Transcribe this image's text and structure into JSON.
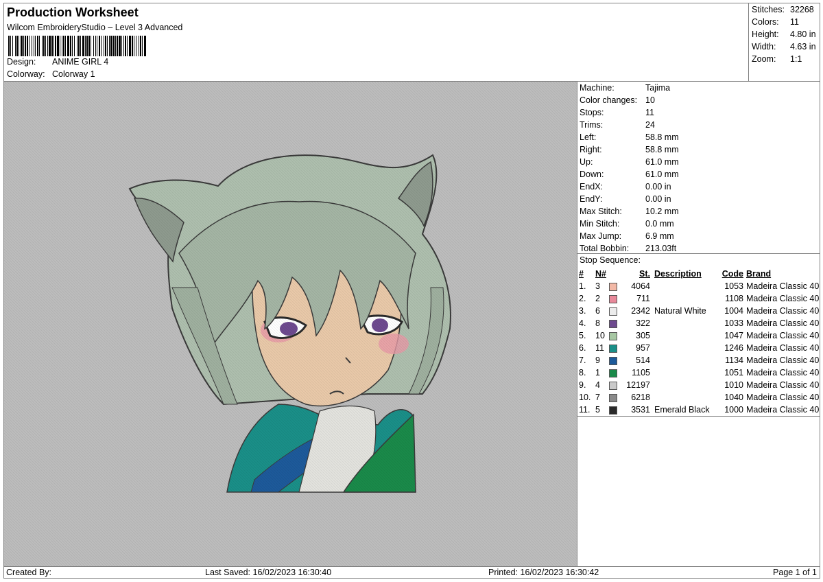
{
  "header": {
    "title": "Production Worksheet",
    "software": "Wilcom EmbroideryStudio – Level 3 Advanced",
    "design_label": "Design:",
    "design_value": "ANIME GIRL 4",
    "colorway_label": "Colorway:",
    "colorway_value": "Colorway 1"
  },
  "stats": [
    {
      "label": "Stitches:",
      "value": "32268"
    },
    {
      "label": "Colors:",
      "value": "11"
    },
    {
      "label": "Height:",
      "value": "4.80 in"
    },
    {
      "label": "Width:",
      "value": "4.63 in"
    },
    {
      "label": "Zoom:",
      "value": "1:1"
    }
  ],
  "machine": [
    {
      "label": "Machine:",
      "value": "Tajima"
    },
    {
      "label": "Color changes:",
      "value": "10"
    },
    {
      "label": "Stops:",
      "value": "11"
    },
    {
      "label": "Trims:",
      "value": "24"
    },
    {
      "label": "Left:",
      "value": "58.8 mm"
    },
    {
      "label": "Right:",
      "value": "58.8 mm"
    },
    {
      "label": "Up:",
      "value": "61.0 mm"
    },
    {
      "label": "Down:",
      "value": "61.0 mm"
    },
    {
      "label": "EndX:",
      "value": "0.00 in"
    },
    {
      "label": "EndY:",
      "value": "0.00 in"
    },
    {
      "label": "Max Stitch:",
      "value": "10.2 mm"
    },
    {
      "label": "Min Stitch:",
      "value": "0.0 mm"
    },
    {
      "label": "Max Jump:",
      "value": "6.9 mm"
    },
    {
      "label": "Total Bobbin:",
      "value": "213.03ft"
    }
  ],
  "stop_sequence": {
    "title": "Stop Sequence:",
    "headers": {
      "idx": "#",
      "n": "N#",
      "st": "St.",
      "desc": "Description",
      "code": "Code",
      "brand": "Brand"
    },
    "rows": [
      {
        "idx": "1.",
        "n": "3",
        "color": "#f2b8a6",
        "st": "4064",
        "desc": "",
        "code": "1053",
        "brand": "Madeira Classic 40"
      },
      {
        "idx": "2.",
        "n": "2",
        "color": "#e8899a",
        "st": "711",
        "desc": "",
        "code": "1108",
        "brand": "Madeira Classic 40"
      },
      {
        "idx": "3.",
        "n": "6",
        "color": "#ececec",
        "st": "2342",
        "desc": "Natural White",
        "code": "1004",
        "brand": "Madeira Classic 40"
      },
      {
        "idx": "4.",
        "n": "8",
        "color": "#6e4a8f",
        "st": "322",
        "desc": "",
        "code": "1033",
        "brand": "Madeira Classic 40"
      },
      {
        "idx": "5.",
        "n": "10",
        "color": "#a7c7a3",
        "st": "305",
        "desc": "",
        "code": "1047",
        "brand": "Madeira Classic 40"
      },
      {
        "idx": "6.",
        "n": "11",
        "color": "#1a8f88",
        "st": "957",
        "desc": "",
        "code": "1246",
        "brand": "Madeira Classic 40"
      },
      {
        "idx": "7.",
        "n": "9",
        "color": "#1d5a9a",
        "st": "514",
        "desc": "",
        "code": "1134",
        "brand": "Madeira Classic 40"
      },
      {
        "idx": "8.",
        "n": "1",
        "color": "#1a8a4a",
        "st": "1105",
        "desc": "",
        "code": "1051",
        "brand": "Madeira Classic 40"
      },
      {
        "idx": "9.",
        "n": "4",
        "color": "#c9c9c9",
        "st": "12197",
        "desc": "",
        "code": "1010",
        "brand": "Madeira Classic 40"
      },
      {
        "idx": "10.",
        "n": "7",
        "color": "#8a8a8a",
        "st": "6218",
        "desc": "",
        "code": "1040",
        "brand": "Madeira Classic 40"
      },
      {
        "idx": "11.",
        "n": "5",
        "color": "#2a2a2a",
        "st": "3531",
        "desc": "Emerald Black",
        "code": "1000",
        "brand": "Madeira Classic 40"
      }
    ]
  },
  "footer": {
    "created": "Created By:",
    "saved": "Last Saved: 16/02/2023 16:30:40",
    "printed": "Printed: 16/02/2023 16:30:42",
    "page": "Page 1 of 1"
  }
}
